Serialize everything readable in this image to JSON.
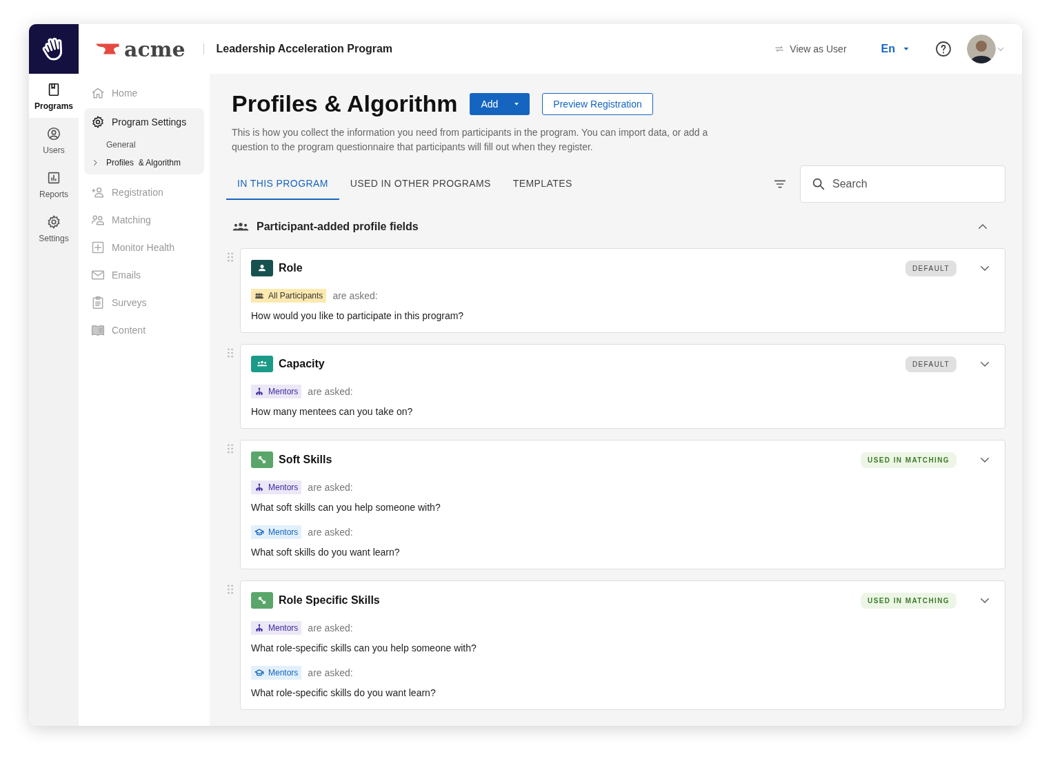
{
  "rail": {
    "items": [
      {
        "label": "Programs",
        "selected": true
      },
      {
        "label": "Users",
        "selected": false
      },
      {
        "label": "Reports",
        "selected": false
      },
      {
        "label": "Settings",
        "selected": false
      }
    ]
  },
  "header": {
    "brand": "acme",
    "program": "Leadership Acceleration Program",
    "view_as": "View as User",
    "language": "En"
  },
  "nav": {
    "items": [
      {
        "label": "Home",
        "expanded": false
      },
      {
        "label": "Program Settings",
        "expanded": true,
        "children": [
          {
            "label": "General",
            "selected": false
          },
          {
            "label": "Profiles  & Algorithm",
            "selected": true
          }
        ]
      },
      {
        "label": "Registration",
        "expanded": false
      },
      {
        "label": "Matching",
        "expanded": false
      },
      {
        "label": "Monitor Health",
        "expanded": false
      },
      {
        "label": "Emails",
        "expanded": false
      },
      {
        "label": "Surveys",
        "expanded": false
      },
      {
        "label": "Content",
        "expanded": false
      }
    ]
  },
  "page": {
    "title": "Profiles & Algorithm",
    "add_button": "Add",
    "preview_button": "Preview Registration",
    "description": "This is how you collect the information you need from participants in the program. You can import data, or add a question to the program questionnaire that participants will fill out when they register."
  },
  "tabs": [
    {
      "label": "IN THIS PROGRAM",
      "selected": true
    },
    {
      "label": "USED IN OTHER PROGRAMS",
      "selected": false
    },
    {
      "label": "TEMPLATES",
      "selected": false
    }
  ],
  "search": {
    "placeholder": "Search"
  },
  "section": {
    "title": "Participant-added profile fields",
    "expanded": true
  },
  "fields": [
    {
      "name": "Role",
      "kind": "person",
      "badge": {
        "label": "DEFAULT",
        "kind": "default"
      },
      "questions": [
        {
          "audience": "All Participants",
          "kind": "all",
          "asked": "are asked:",
          "prompt": "How would you like to participate in this program?"
        }
      ]
    },
    {
      "name": "Capacity",
      "kind": "group",
      "badge": {
        "label": "DEFAULT",
        "kind": "default"
      },
      "questions": [
        {
          "audience": "Mentors",
          "kind": "mentor",
          "asked": "are asked:",
          "prompt": "How many mentees can you take on?"
        }
      ]
    },
    {
      "name": "Soft Skills",
      "kind": "arrows",
      "badge": {
        "label": "USED IN MATCHING",
        "kind": "matching"
      },
      "questions": [
        {
          "audience": "Mentors",
          "kind": "mentor",
          "asked": "are asked:",
          "prompt": "What soft skills can you help someone with?"
        },
        {
          "audience": "Mentors",
          "kind": "learner",
          "asked": "are asked:",
          "prompt": "What soft skills do you want learn?"
        }
      ]
    },
    {
      "name": "Role Specific Skills",
      "kind": "arrows",
      "badge": {
        "label": "USED IN MATCHING",
        "kind": "matching"
      },
      "questions": [
        {
          "audience": "Mentors",
          "kind": "mentor",
          "asked": "are asked:",
          "prompt": "What role-specific skills can you help someone with?"
        },
        {
          "audience": "Mentors",
          "kind": "learner",
          "asked": "are asked:",
          "prompt": "What role-specific skills do you want learn?"
        }
      ]
    }
  ]
}
